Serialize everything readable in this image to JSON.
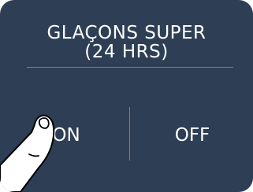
{
  "panel": {
    "title_line1": "GLAÇONS SUPER",
    "title_line2": "(24 HRS)",
    "accent_color": "#3f8fd0",
    "background_color": "#2e3f55"
  },
  "options": {
    "on_label": "ON",
    "off_label": "OFF"
  },
  "gesture": {
    "icon": "finger-tap-icon",
    "target": "ON"
  }
}
